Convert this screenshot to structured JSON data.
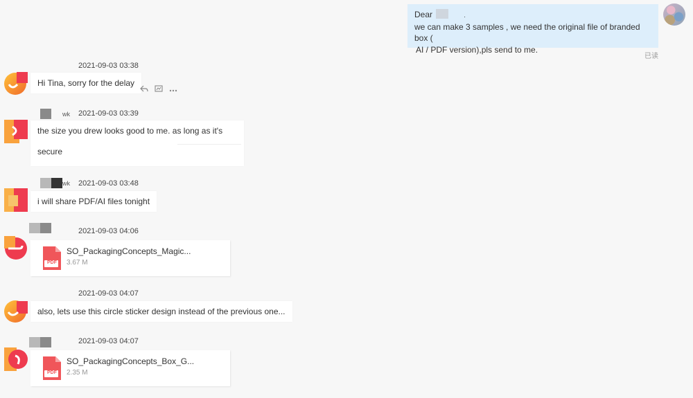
{
  "outgoing": {
    "greeting": "Dear",
    "line1": "we can make 3 samples , we need the original file of branded box (",
    "line2": "AI / PDF version),pls send to me.",
    "read_status": "已读"
  },
  "messages": [
    {
      "time": "2021-09-03 03:38",
      "text": "Hi Tina, sorry for the delay"
    },
    {
      "sender_suffix": "wk",
      "time": "2021-09-03 03:39",
      "text": "the size you drew looks good to me. as long as it's secure"
    },
    {
      "sender_suffix": "wk",
      "time": "2021-09-03 03:48",
      "text": "i will share PDF/AI files tonight"
    },
    {
      "time": "2021-09-03 04:06",
      "file": {
        "name": "SO_PackagingConcepts_Magic...",
        "size": "3.67 M",
        "icon_label": "PDF"
      }
    },
    {
      "time": "2021-09-03 04:07",
      "text": "also, lets use this circle sticker design instead of the previous one..."
    },
    {
      "time": "2021-09-03 04:07",
      "file": {
        "name": "SO_PackagingConcepts_Box_G...",
        "size": "2.35 M",
        "icon_label": "PDF"
      }
    }
  ],
  "icons": {
    "reply": "reply-icon",
    "quote": "image-reply-icon",
    "more": "more-icon"
  },
  "colors": {
    "outgoing_bubble": "#ddeefb",
    "pdf_red": "#f0565a",
    "avatar_orange": "#f9a23d",
    "avatar_red": "#ee3b4f"
  }
}
